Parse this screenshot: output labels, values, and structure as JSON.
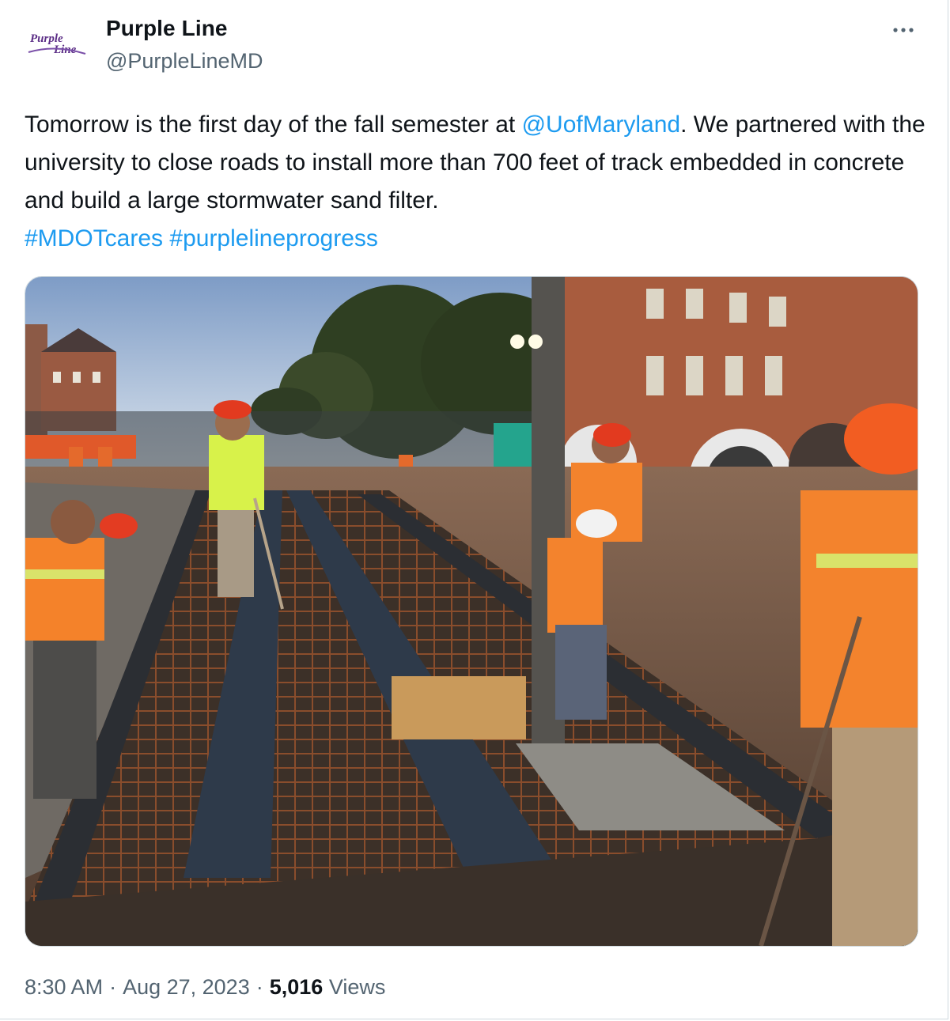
{
  "tweet": {
    "display_name": "Purple Line",
    "handle": "@PurpleLineMD",
    "avatar_text_top": "Purple",
    "avatar_text_bottom": "Line",
    "body": {
      "part1": "Tomorrow is the first day of the fall semester at ",
      "mention": "@UofMaryland",
      "part2": ". We partnered with the university to close roads to install more than 700 feet of track embedded in concrete and build a large stormwater sand filter.",
      "hashtag1": "#MDOTcares",
      "hashtag2": "#purplelineprogress"
    },
    "time": "8:30 AM",
    "date": "Aug 27, 2023",
    "dot": "·",
    "views_count": "5,016",
    "views_label": "Views"
  },
  "icons": {
    "more": "more-horizontal-icon"
  },
  "colors": {
    "link": "#1d9bf0",
    "secondary_text": "#536471",
    "primary_text": "#0f1419",
    "brand_purple": "#5b2d86"
  }
}
